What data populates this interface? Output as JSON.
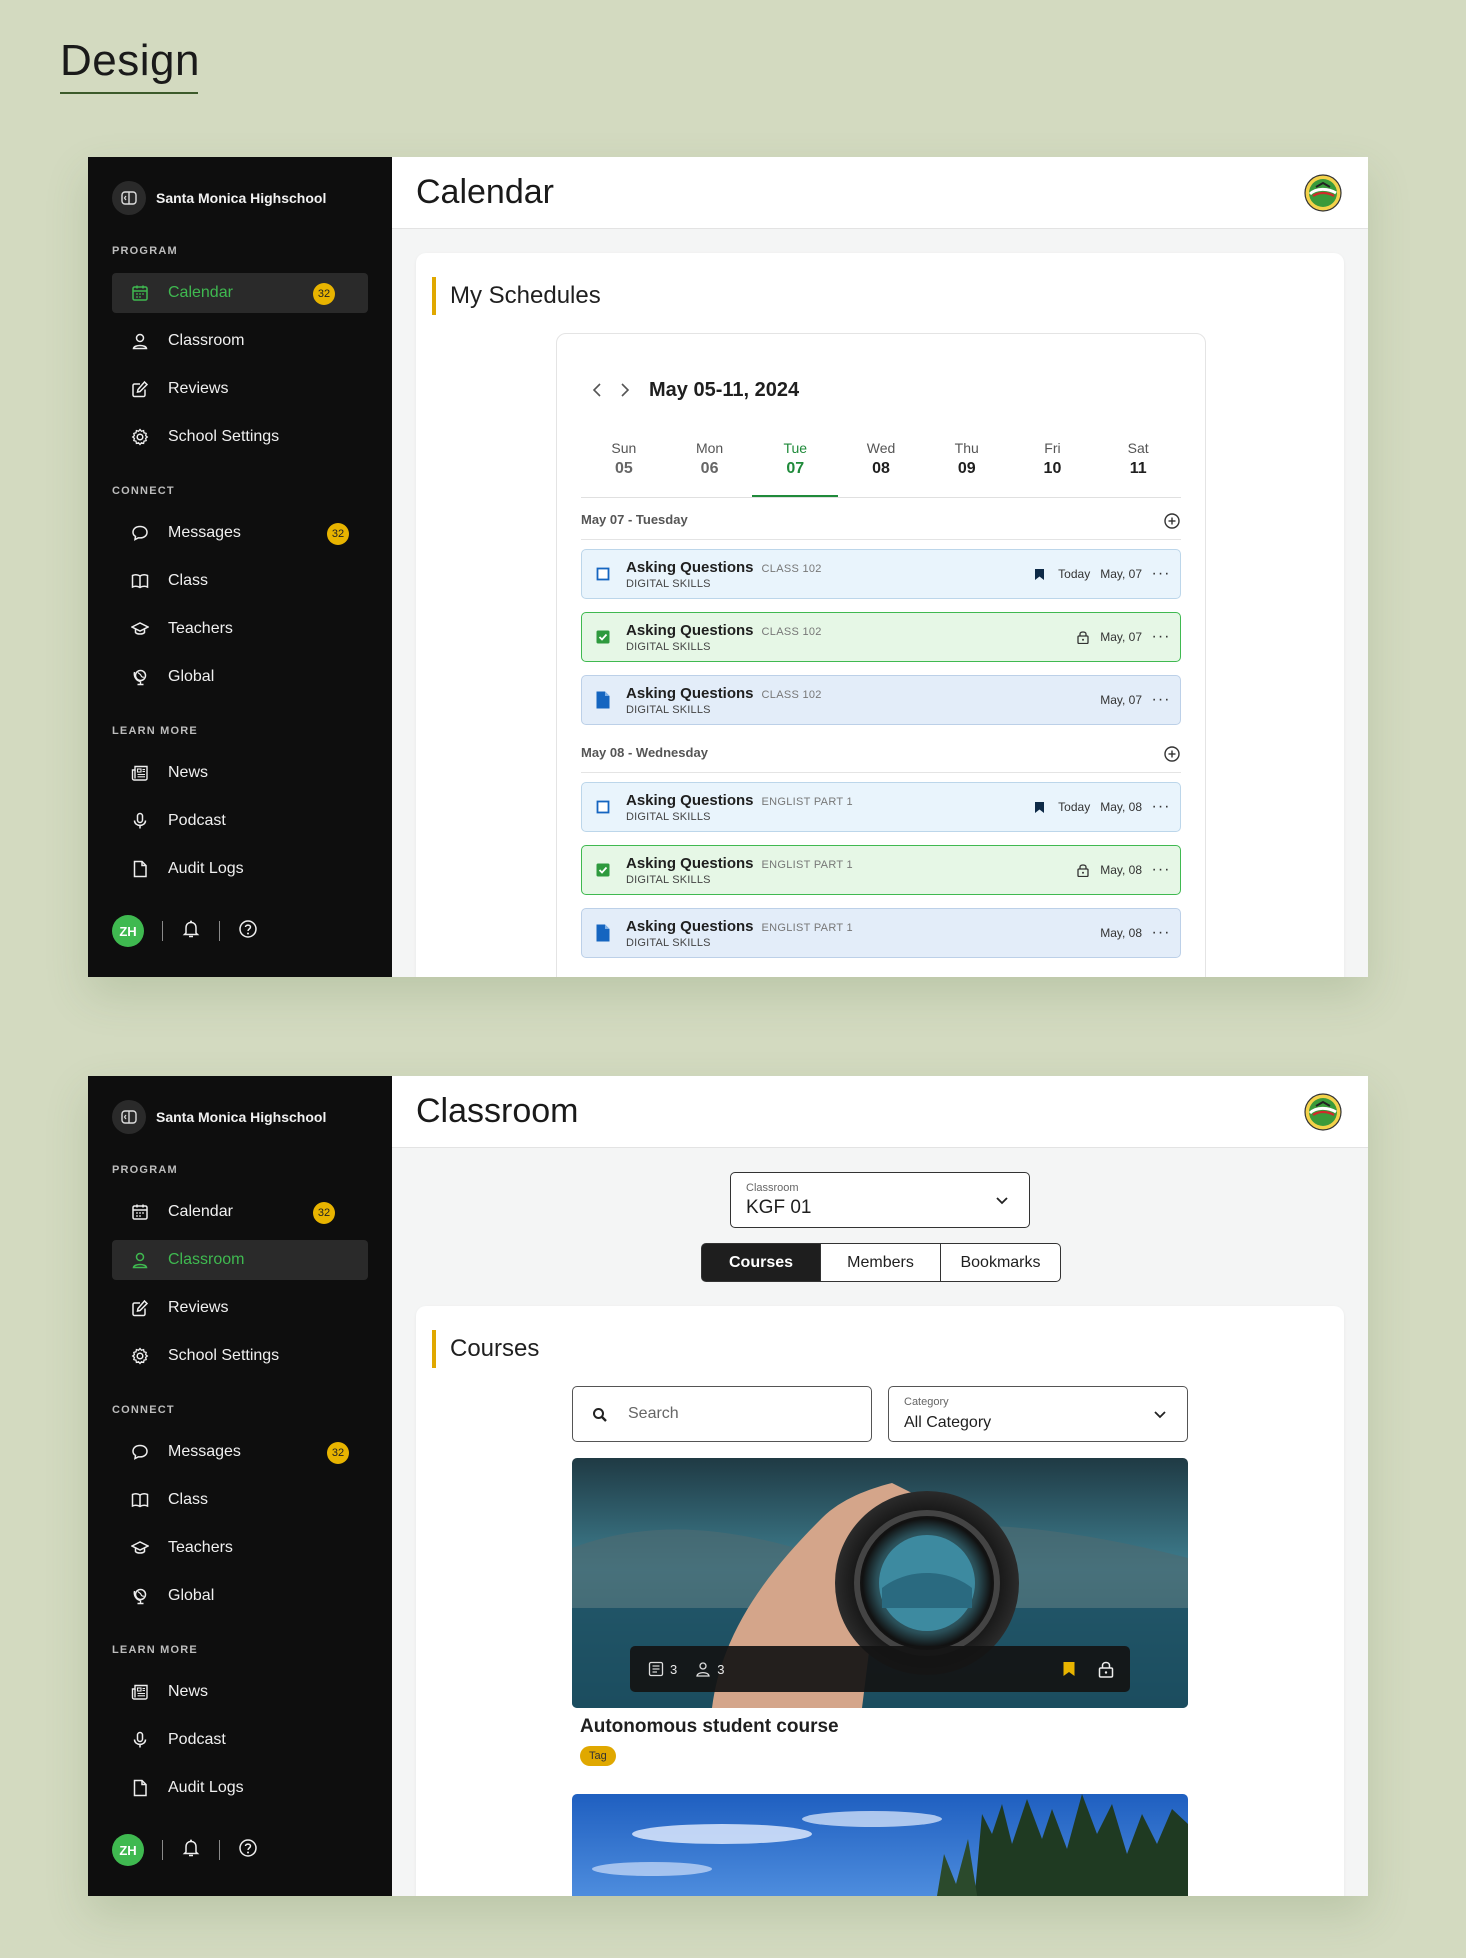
{
  "page": {
    "heading": "Design"
  },
  "sidebar": {
    "school_name": "Santa Monica Highschool",
    "sections": {
      "program": "PROGRAM",
      "connect": "CONNECT",
      "learn_more": "LEARN MORE"
    },
    "items": {
      "calendar": {
        "label": "Calendar",
        "badge": "32"
      },
      "classroom": {
        "label": "Classroom"
      },
      "reviews": {
        "label": "Reviews"
      },
      "school_settings": {
        "label": "School Settings"
      },
      "messages": {
        "label": "Messages",
        "badge": "32"
      },
      "class": {
        "label": "Class"
      },
      "teachers": {
        "label": "Teachers"
      },
      "global": {
        "label": "Global"
      },
      "news": {
        "label": "News"
      },
      "podcast": {
        "label": "Podcast"
      },
      "audit_logs": {
        "label": "Audit Logs"
      }
    },
    "user_initials": "ZH",
    "active_color": "#3fb950",
    "badge_color": "#e8b400"
  },
  "calendar_screen": {
    "title": "Calendar",
    "card_title": "My Schedules",
    "range": "May 05-11, 2024",
    "days": [
      {
        "name": "Sun",
        "date": "05"
      },
      {
        "name": "Mon",
        "date": "06"
      },
      {
        "name": "Tue",
        "date": "07"
      },
      {
        "name": "Wed",
        "date": "08"
      },
      {
        "name": "Thu",
        "date": "09"
      },
      {
        "name": "Fri",
        "date": "10"
      },
      {
        "name": "Sat",
        "date": "11"
      }
    ],
    "selected_day": "Tue",
    "groups": [
      {
        "header": "May 07 - Tuesday",
        "events": [
          {
            "title": "Asking Questions",
            "class": "CLASS 102",
            "subtitle": "DIGITAL SKILLS",
            "today": "Today",
            "date": "May, 07",
            "status": "todo"
          },
          {
            "title": "Asking Questions",
            "class": "CLASS 102",
            "subtitle": "DIGITAL SKILLS",
            "date": "May, 07",
            "status": "done"
          },
          {
            "title": "Asking Questions",
            "class": "CLASS 102",
            "subtitle": "DIGITAL SKILLS",
            "date": "May, 07",
            "status": "document"
          }
        ]
      },
      {
        "header": "May 08 - Wednesday",
        "events": [
          {
            "title": "Asking Questions",
            "class": "ENGLIST PART 1",
            "subtitle": "DIGITAL SKILLS",
            "today": "Today",
            "date": "May, 08",
            "status": "todo"
          },
          {
            "title": "Asking Questions",
            "class": "ENGLIST PART 1",
            "subtitle": "DIGITAL SKILLS",
            "date": "May, 08",
            "status": "done"
          },
          {
            "title": "Asking Questions",
            "class": "ENGLIST PART 1",
            "subtitle": "DIGITAL SKILLS",
            "date": "May, 08",
            "status": "document"
          }
        ]
      }
    ],
    "accent_color": "#1f8a3a"
  },
  "classroom_screen": {
    "title": "Classroom",
    "classroom_select": {
      "label": "Classroom",
      "value": "KGF 01"
    },
    "tabs": [
      "Courses",
      "Members",
      "Bookmarks"
    ],
    "active_tab": "Courses",
    "card_title": "Courses",
    "search": {
      "placeholder": "Search"
    },
    "category": {
      "label": "Category",
      "value": "All Category"
    },
    "courses": [
      {
        "title": "Autonomous student course",
        "tag": "Tag",
        "lessons": "3",
        "members": "3",
        "bookmarked": true,
        "locked": true
      }
    ]
  }
}
